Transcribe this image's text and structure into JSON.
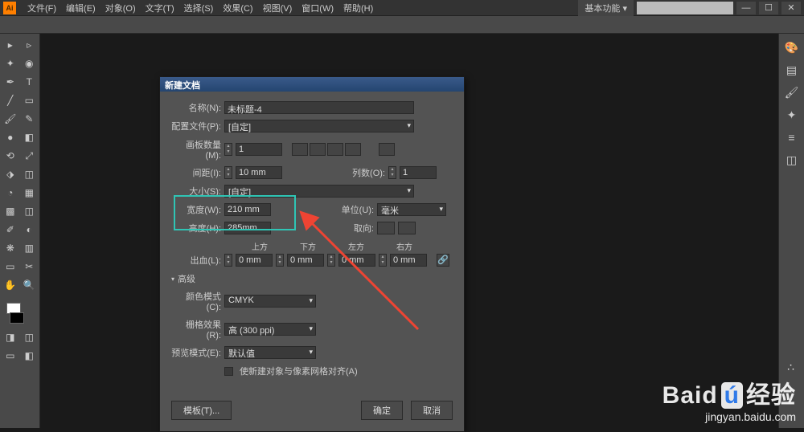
{
  "menubar": {
    "items": [
      "文件(F)",
      "编辑(E)",
      "对象(O)",
      "文字(T)",
      "选择(S)",
      "效果(C)",
      "视图(V)",
      "窗口(W)",
      "帮助(H)"
    ],
    "workspace": "基本功能",
    "window_min": "—",
    "window_max": "☐",
    "window_close": "✕"
  },
  "dialog": {
    "title": "新建文档",
    "labels": {
      "name": "名称(N):",
      "profile": "配置文件(P):",
      "artboards": "画板数量(M):",
      "spacing": "间距(I):",
      "columns": "列数(O):",
      "size": "大小(S):",
      "width": "宽度(W):",
      "height": "高度(H):",
      "units": "单位(U):",
      "orientation": "取向:",
      "bleed": "出血(L):",
      "bleed_top": "上方",
      "bleed_bottom": "下方",
      "bleed_left": "左方",
      "bleed_right": "右方",
      "advanced": "高级",
      "color_mode": "颜色模式(C):",
      "raster": "栅格效果(R):",
      "preview": "预览模式(E):",
      "align_pixel": "使新建对象与像素网格对齐(A)"
    },
    "values": {
      "name": "未标题-4",
      "profile": "[自定]",
      "artboards": "1",
      "spacing": "10 mm",
      "columns": "1",
      "size": "[自定]",
      "width": "210 mm",
      "height": "285mm",
      "units": "毫米",
      "bleed_top": "0 mm",
      "bleed_bottom": "0 mm",
      "bleed_left": "0 mm",
      "bleed_right": "0 mm",
      "color_mode": "CMYK",
      "raster": "高 (300 ppi)",
      "preview": "默认值"
    },
    "buttons": {
      "template": "模板(T)...",
      "ok": "确定",
      "cancel": "取消"
    }
  },
  "watermark": {
    "brand": "Baid",
    "suffix": "经验",
    "url": "jingyan.baidu.com",
    "paw": "∴"
  }
}
